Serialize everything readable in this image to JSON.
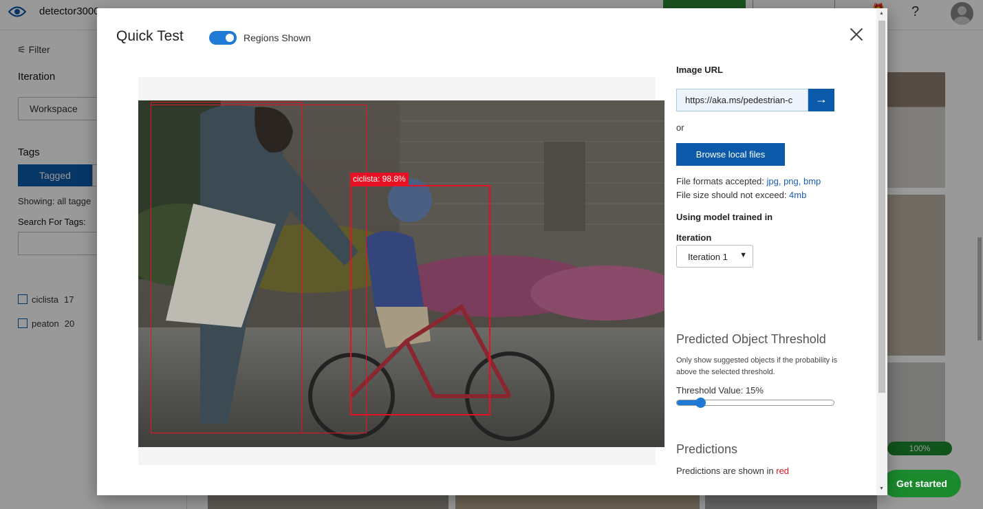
{
  "app": {
    "name": "detector3000",
    "help_label": "?",
    "gift_icon": "gift-icon"
  },
  "left_panel": {
    "filter_label": "Filter",
    "iteration_label": "Iteration",
    "workspace_value": "Workspace",
    "tags_label": "Tags",
    "tagged_tab": "Tagged",
    "showing_text": "Showing: all tagge",
    "search_tags_label": "Search For Tags:",
    "tags": [
      {
        "name": "ciclista",
        "count": "17"
      },
      {
        "name": "peaton",
        "count": "20"
      }
    ]
  },
  "gallery": {
    "progress": "100%",
    "get_started": "Get started"
  },
  "modal": {
    "title": "Quick Test",
    "regions_toggle_label": "Regions Shown",
    "regions_shown": true,
    "image_url_label": "Image URL",
    "image_url_value": "https://aka.ms/pedestrian-c",
    "or_text": "or",
    "browse_label": "Browse local files",
    "formats_prefix": "File formats accepted: ",
    "formats_value": "jpg, png, bmp",
    "size_prefix": "File size should not exceed: ",
    "size_value": "4mb",
    "model_label": "Using model trained in",
    "iteration_label": "Iteration",
    "iteration_value": "Iteration 1",
    "threshold_title": "Predicted Object Threshold",
    "threshold_desc": "Only show suggested objects if the probability is above the selected threshold.",
    "threshold_value_label": "Threshold Value: 15%",
    "threshold_value": 0.15,
    "predictions_title": "Predictions",
    "predictions_prefix": "Predictions are shown in ",
    "predictions_color_word": "red",
    "detections": [
      {
        "label": "ciclista: 98.8%"
      }
    ]
  },
  "colors": {
    "accent": "#0a5aa9",
    "toggle": "#1e7ad4",
    "prediction": "#e81123",
    "success": "#1b8a2e"
  }
}
